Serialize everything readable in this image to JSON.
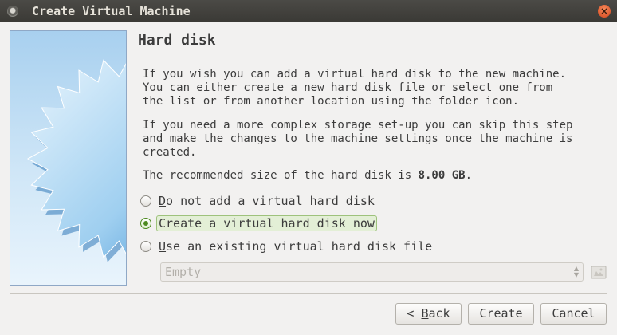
{
  "window": {
    "title": "Create Virtual Machine",
    "close_icon": "close-icon"
  },
  "page": {
    "heading": "Hard disk",
    "paragraph1": "If you wish you can add a virtual hard disk to the new machine.\nYou can either create a new hard disk file or select one from\nthe list or from another location using the folder icon.",
    "paragraph2": "If you need a more complex storage set-up you can skip this step\nand make the changes to the machine settings once the machine is\ncreated.",
    "recommended_prefix": "The recommended size of the hard disk is ",
    "recommended_size": "8.00 GB",
    "recommended_suffix": "."
  },
  "options": [
    {
      "mnemonic": "D",
      "rest": "o not add a virtual hard disk",
      "selected": false
    },
    {
      "mnemonic": "",
      "rest": "Create a virtual hard disk now",
      "selected": true
    },
    {
      "mnemonic": "U",
      "rest": "se an existing virtual hard disk file",
      "selected": false
    }
  ],
  "disk_combo": {
    "value": "Empty",
    "enabled": false
  },
  "buttons": {
    "back_prefix": "< ",
    "back_mnemonic": "B",
    "back_rest": "ack",
    "create": "Create",
    "cancel": "Cancel"
  },
  "colors": {
    "accent": "#4c8a1f",
    "titlebar": "#3c3b37",
    "panel_blue": "#a8d0ef"
  }
}
